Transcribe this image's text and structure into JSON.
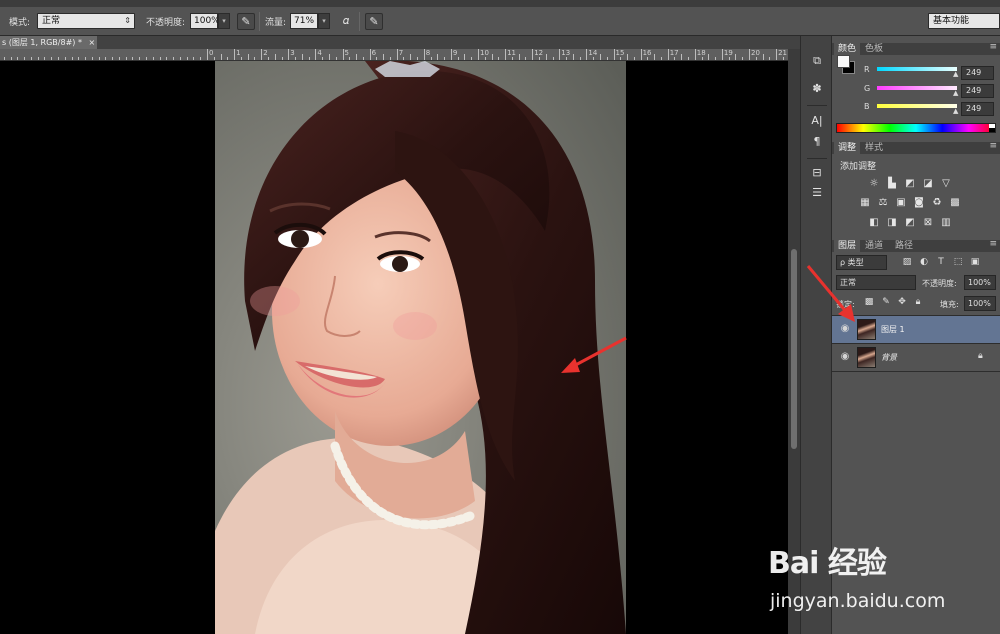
{
  "options_bar": {
    "mode_label": "模式:",
    "mode_value": "正常",
    "opacity_label": "不透明度:",
    "opacity_value": "100%",
    "flow_label": "流量:",
    "flow_value": "71%",
    "workspace_value": "基本功能"
  },
  "document": {
    "tab_title": "s (图层 1, RGB/8#) *",
    "close_glyph": "×"
  },
  "ruler": {
    "ticks": [
      "0",
      "1",
      "2",
      "3",
      "4",
      "5",
      "6",
      "7",
      "8",
      "9",
      "10",
      "11",
      "12",
      "13",
      "14",
      "15",
      "16",
      "17",
      "18",
      "19",
      "20",
      "21"
    ]
  },
  "color_panel": {
    "tabs": [
      "颜色",
      "色板"
    ],
    "channels": [
      {
        "label": "R",
        "value": "249",
        "color": "#00d8ff"
      },
      {
        "label": "G",
        "value": "249",
        "color": "#ff3cff"
      },
      {
        "label": "B",
        "value": "249",
        "color": "#ffff3c"
      }
    ]
  },
  "adjustments_panel": {
    "tabs": [
      "调整",
      "样式"
    ],
    "title": "添加调整"
  },
  "layers_panel": {
    "tabs": [
      "图层",
      "通道",
      "路径"
    ],
    "filter_value": "ρ 类型",
    "blend_value": "正常",
    "opacity_label": "不透明度:",
    "opacity_value": "100%",
    "lock_label": "锁定:",
    "fill_label": "填充:",
    "fill_value": "100%",
    "layers": [
      {
        "name": "图层 1",
        "selected": true
      },
      {
        "name": "背景",
        "selected": false
      }
    ]
  },
  "watermark": {
    "logo": "Bai 经验",
    "url": "jingyan.baidu.com"
  },
  "colors": {
    "annotation_arrow": "#e8322e",
    "selected_layer": "#637593"
  }
}
